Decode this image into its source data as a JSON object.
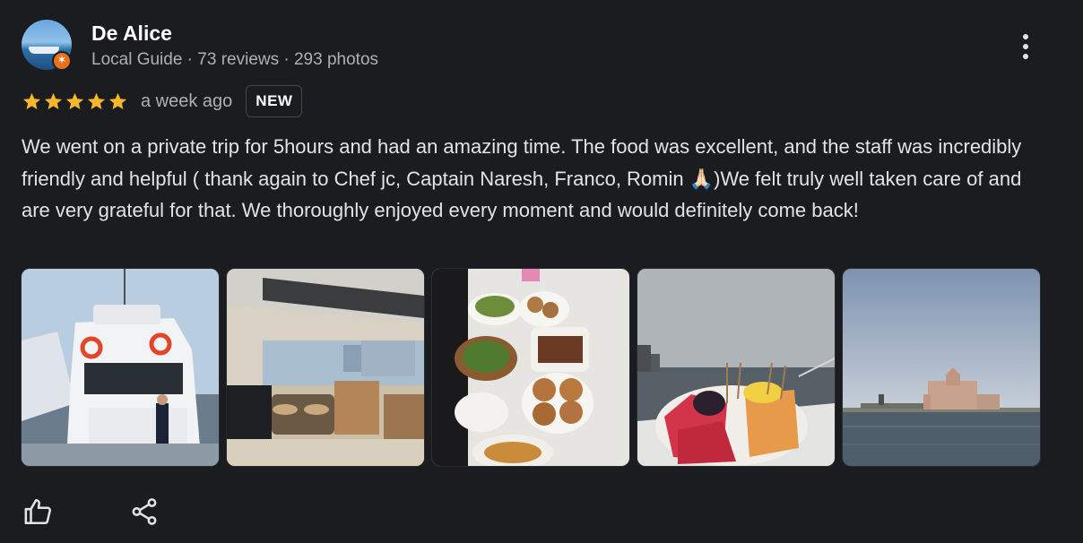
{
  "reviewer": {
    "name": "De Alice",
    "meta": "Local Guide · 73 reviews · 293 photos",
    "badge_glyph": "✶",
    "badge_color": "#e8711c"
  },
  "rating": {
    "stars": 5,
    "star_color": "#f6b82a",
    "time": "a week ago",
    "badge": "NEW"
  },
  "review_text": "We went on a private trip for 5hours and had an amazing time. The food was excellent, and the staff was incredibly friendly and helpful ( thank again to Chef jc, Captain Naresh, Franco, Romin 🙏🏻)We felt truly well taken care of and are very grateful for that. We thoroughly enjoyed every moment and would definitely come back!",
  "photos": [
    {
      "subject": "yacht-stern-photo"
    },
    {
      "subject": "yacht-interior-photo"
    },
    {
      "subject": "food-table-photo"
    },
    {
      "subject": "fruit-platter-photo"
    },
    {
      "subject": "atlantis-skyline-photo"
    }
  ],
  "actions": [
    {
      "icon": "thumbs-up-icon"
    },
    {
      "icon": "share-icon"
    }
  ],
  "colors": {
    "background": "#1b1c20",
    "text": "#e3e3e3",
    "secondary_text": "#aeb0b4"
  }
}
